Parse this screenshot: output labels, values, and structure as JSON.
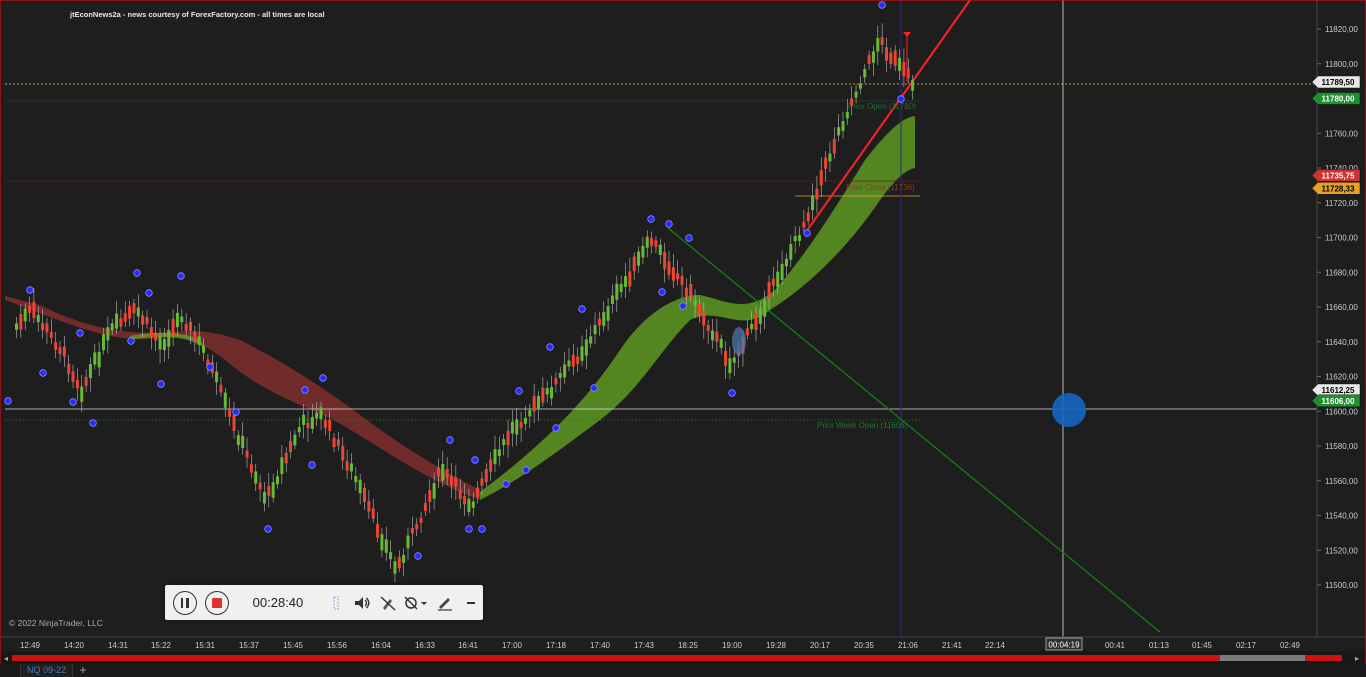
{
  "header": {
    "news_text": "jtEconNews2a - news courtesy of ForexFactory.com - all times are local"
  },
  "copyright": "© 2022 NinjaTrader, LLC",
  "price_axis": {
    "ticks": [
      "11820,00",
      "11800,00",
      "11780,00",
      "11760,00",
      "11740,00",
      "11720,00",
      "11700,00",
      "11680,00",
      "11660,00",
      "11640,00",
      "11620,00",
      "11600,00",
      "11580,00",
      "11560,00",
      "11540,00",
      "11520,00",
      "11500,00"
    ],
    "markers": [
      {
        "label": "11789,50",
        "style": "white"
      },
      {
        "label": "11780,00",
        "style": "green"
      },
      {
        "label": "11735,75",
        "style": "red"
      },
      {
        "label": "11728,33",
        "style": "orange"
      },
      {
        "label": "11612,25",
        "style": "white"
      },
      {
        "label": "11606,00",
        "style": "green"
      }
    ]
  },
  "time_axis": {
    "ticks": [
      "12:49",
      "14:20",
      "14:31",
      "15:22",
      "15:31",
      "15:37",
      "15:45",
      "15:56",
      "16:04",
      "16:33",
      "16:41",
      "17:00",
      "17:18",
      "17:40",
      "17:43",
      "18:25",
      "19:00",
      "19:28",
      "20:17",
      "20:35",
      "21:06",
      "21:41",
      "22:14",
      "00:41",
      "01:13",
      "01:45",
      "02:17",
      "02:49"
    ],
    "cursor_label": "00:04:19"
  },
  "annotations": {
    "prior_open": "Prior Open (11780)",
    "prior_close": "Prior Close (11736)",
    "prior_week_open": "Prior Week Open (11606)"
  },
  "recorder": {
    "elapsed": "00:28:40",
    "buttons": [
      "pause",
      "stop",
      "volume",
      "pen-off",
      "webcam-off",
      "annotate",
      "minimize"
    ]
  },
  "tabs": [
    {
      "label": "NQ 09-22"
    }
  ],
  "colors": {
    "background": "#1e1e1e",
    "up_candle": "#66bb33",
    "down_candle": "#ee4433",
    "ribbon_green": "#66aa22",
    "ribbon_red": "#aa3333",
    "swing_dot": "#2a2aff",
    "trend_red": "#ff2222",
    "trend_green": "#118811",
    "cursor_dot": "#1565c0"
  }
}
